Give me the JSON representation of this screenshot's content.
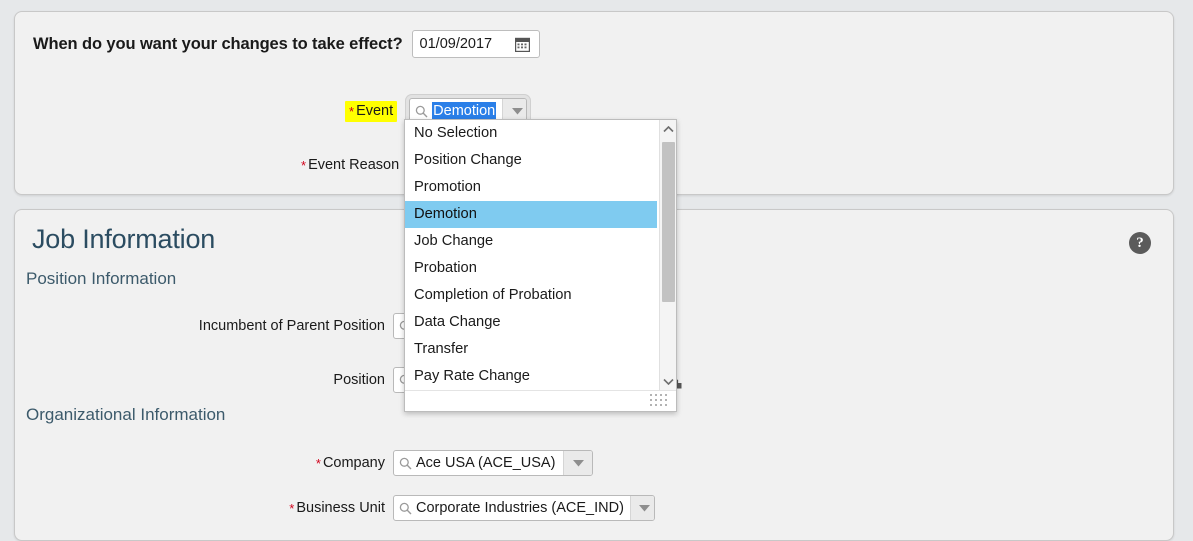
{
  "effective_date_panel": {
    "question": "When do you want your changes to take effect?",
    "date_value": "01/09/2017",
    "calendar_icon": "calendar-icon",
    "event": {
      "star": "*",
      "label": "Event",
      "value": "Demotion",
      "search_icon": "search-icon",
      "dropdown_arrow_icon": "chevron-down-icon"
    },
    "event_reason": {
      "star": "*",
      "label": "Event Reason",
      "value": ""
    }
  },
  "event_dropdown": {
    "options": [
      "No Selection",
      "Position Change",
      "Promotion",
      "Demotion",
      "Job Change",
      "Probation",
      "Completion of Probation",
      "Data Change",
      "Transfer",
      "Pay Rate Change"
    ],
    "selected": "Demotion",
    "scroll_up_icon": "chevron-up-icon",
    "scroll_down_icon": "chevron-down-icon",
    "resize_grip_icon": "resize-grip-icon",
    "highlight_color": "#7fcbf0"
  },
  "job_information_panel": {
    "title": "Job Information",
    "help_icon": "help-icon",
    "help_glyph": "?",
    "position_information": {
      "title": "Position Information",
      "fields": [
        {
          "star": "",
          "label": "Incumbent of Parent Position",
          "value": "",
          "search_icon": "search-icon",
          "dropdown_arrow_icon": "chevron-down-icon"
        },
        {
          "star": "",
          "label": "Position",
          "value": "",
          "search_icon": "search-icon",
          "dropdown_arrow_icon": "chevron-down-icon",
          "extra_icon": "org-chart-icon"
        }
      ]
    },
    "organizational_information": {
      "title": "Organizational Information",
      "fields": [
        {
          "star": "*",
          "label": "Company",
          "value": "Ace USA (ACE_USA)",
          "search_icon": "search-icon",
          "dropdown_arrow_icon": "chevron-down-icon"
        },
        {
          "star": "*",
          "label": "Business Unit",
          "value": "Corporate Industries (ACE_IND)",
          "search_icon": "search-icon",
          "dropdown_arrow_icon": "chevron-down-icon"
        }
      ]
    }
  }
}
